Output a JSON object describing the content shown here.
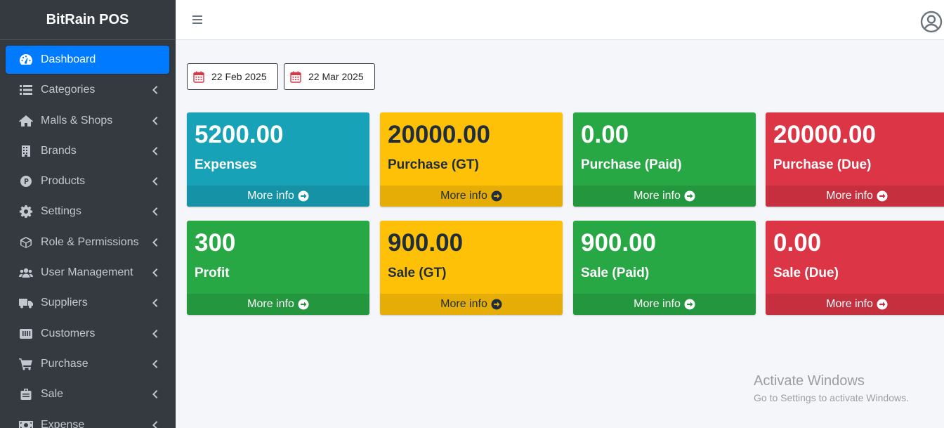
{
  "brand": {
    "title": "BitRain POS"
  },
  "sidebar": {
    "items": [
      {
        "label": "Dashboard",
        "icon": "tachometer-icon",
        "active": true
      },
      {
        "label": "Categories",
        "icon": "list-icon"
      },
      {
        "label": "Malls & Shops",
        "icon": "home-icon"
      },
      {
        "label": "Brands",
        "icon": "building-icon"
      },
      {
        "label": "Products",
        "icon": "product-p-icon"
      },
      {
        "label": "Settings",
        "icon": "gear-icon"
      },
      {
        "label": "Role & Permissions",
        "icon": "cube-icon"
      },
      {
        "label": "User Management",
        "icon": "users-icon"
      },
      {
        "label": "Suppliers",
        "icon": "truck-icon"
      },
      {
        "label": "Customers",
        "icon": "customer-icon"
      },
      {
        "label": "Purchase",
        "icon": "cart-icon"
      },
      {
        "label": "Sale",
        "icon": "suitcase-icon"
      },
      {
        "label": "Expense",
        "icon": "money-icon"
      }
    ]
  },
  "filters": {
    "start_date": "22 Feb 2025",
    "end_date": "22 Mar 2025"
  },
  "cards": [
    {
      "value": "5200.00",
      "label": "Expenses",
      "more": "More info",
      "color": "#17a2b8"
    },
    {
      "value": "20000.00",
      "label": "Purchase (GT)",
      "more": "More info",
      "color": "#ffc107"
    },
    {
      "value": "0.00",
      "label": "Purchase (Paid)",
      "more": "More info",
      "color": "#28a745"
    },
    {
      "value": "20000.00",
      "label": "Purchase (Due)",
      "more": "More info",
      "color": "#dc3545"
    },
    {
      "value": "300",
      "label": "Profit",
      "more": "More info",
      "color": "#28a745"
    },
    {
      "value": "900.00",
      "label": "Sale (GT)",
      "more": "More info",
      "color": "#ffc107"
    },
    {
      "value": "900.00",
      "label": "Sale (Paid)",
      "more": "More info",
      "color": "#28a745"
    },
    {
      "value": "0.00",
      "label": "Sale (Due)",
      "more": "More info",
      "color": "#dc3545"
    }
  ],
  "watermark": {
    "line1": "Activate Windows",
    "line2": "Go to Settings to activate Windows."
  }
}
